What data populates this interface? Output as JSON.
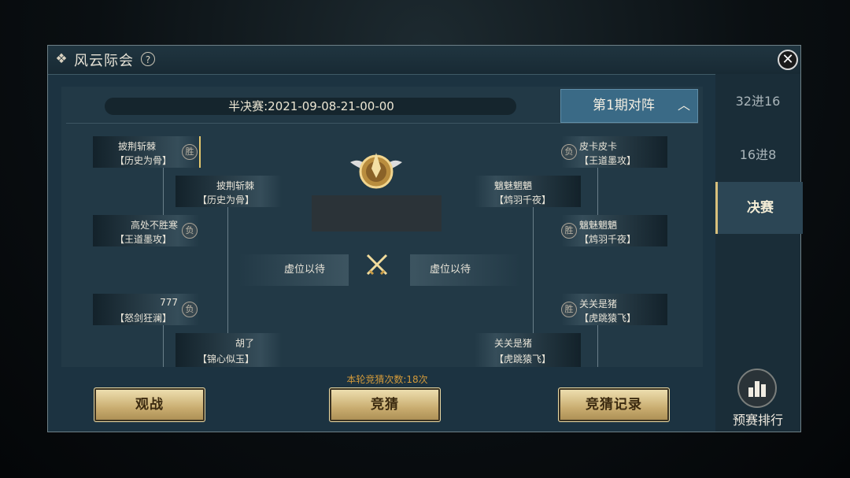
{
  "window": {
    "title": "风云际会",
    "help_label": "?",
    "close_label": "✕"
  },
  "stage": {
    "text": "半决赛:2021-09-08-21-00-00"
  },
  "period": {
    "label": "第1期对阵",
    "chevron": "︿"
  },
  "bracket": {
    "left": [
      {
        "name": "披荆斩棘",
        "guild": "【历史为骨】",
        "badge": "胜"
      },
      {
        "name": "高处不胜寒",
        "guild": "【王道墨攻】",
        "badge": "负"
      },
      {
        "name": "777",
        "guild": "【怒剑狂澜】",
        "badge": "负"
      }
    ],
    "left_round2": [
      {
        "name": "披荆斩棘",
        "guild": "【历史为骨】"
      },
      {
        "name": "胡了",
        "guild": "【锦心似玉】"
      }
    ],
    "right": [
      {
        "name": "皮卡皮卡",
        "guild": "【王道墨攻】",
        "badge": "负"
      },
      {
        "name": "魑魅魍魉",
        "guild": "【鸩羽千夜】",
        "badge": "胜"
      },
      {
        "name": "关关是猪",
        "guild": "【虎跳猿飞】",
        "badge": "胜"
      }
    ],
    "right_round2": [
      {
        "name": "魑魅魍魉",
        "guild": "【鸩羽千夜】"
      },
      {
        "name": "关关是猪",
        "guild": "【虎跳猿飞】"
      }
    ],
    "final_left": "虚位以待",
    "final_right": "虚位以待"
  },
  "guess": {
    "info": "本轮竞猜次数:18次"
  },
  "buttons": {
    "watch": "观战",
    "guess": "竞猜",
    "record": "竞猜记录"
  },
  "sidebar": {
    "tabs": [
      "32进16",
      "16进8",
      "决赛"
    ],
    "active": "决赛",
    "rank_label": "预赛排行"
  },
  "colors": {
    "gold": "#d8c07c",
    "panel": "#1c3341",
    "accent_btn": "#3a6a86",
    "guess_text": "#d39a3a"
  }
}
